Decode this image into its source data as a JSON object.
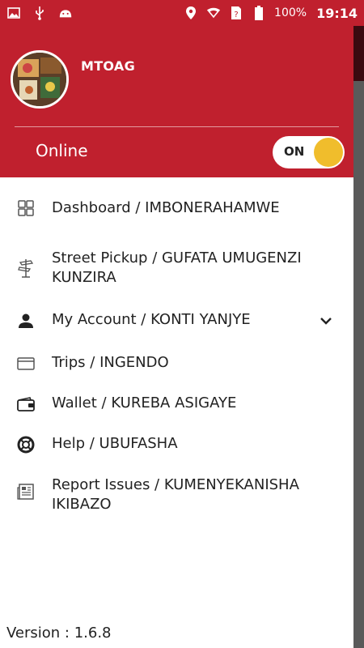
{
  "status_bar": {
    "icons_left": [
      "image-icon",
      "usb-icon",
      "android-icon"
    ],
    "icons_right": [
      "location-icon",
      "wifi-icon",
      "sim-icon",
      "battery-icon"
    ],
    "battery": "100%",
    "time": "19:14"
  },
  "drawer": {
    "username": "MTOAG",
    "online_label": "Online",
    "toggle_label": "ON",
    "online": true
  },
  "menu": {
    "items": [
      {
        "label": "Dashboard / IMBONERAHAMWE",
        "icon": "dashboard-icon"
      },
      {
        "label": "Street Pickup / GUFATA UMUGENZI KUNZIRA",
        "icon": "street-sign-icon"
      },
      {
        "label": "My Account / KONTI YANJYE",
        "icon": "person-icon"
      },
      {
        "label": "Trips / INGENDO",
        "icon": "card-icon"
      },
      {
        "label": "Wallet / KUREBA ASIGAYE",
        "icon": "wallet-icon"
      },
      {
        "label": "Help / UBUFASHA",
        "icon": "lifebuoy-icon"
      },
      {
        "label": "Report Issues / KUMENYEKANISHA IKIBAZO",
        "icon": "newspaper-icon"
      }
    ]
  },
  "footer": {
    "version": "Version : 1.6.8"
  },
  "colors": {
    "brand_red": "#c0202e",
    "toggle_knob": "#f0bd2c"
  }
}
